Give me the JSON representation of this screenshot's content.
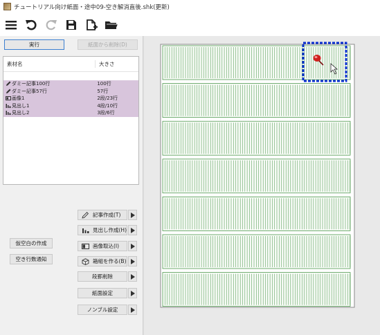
{
  "window": {
    "title": "チュートリアル向け紙面・途中09-空き解消直後.shk(更新)"
  },
  "toolbar": {
    "items": [
      {
        "icon": "menu-icon"
      },
      {
        "icon": "undo-icon"
      },
      {
        "icon": "redo-icon"
      },
      {
        "icon": "save-icon"
      },
      {
        "icon": "new-document-icon"
      },
      {
        "icon": "open-folder-icon"
      }
    ]
  },
  "actions": {
    "execute": "実行",
    "remove_from_page": "紙面から削除(D)"
  },
  "materials": {
    "columns": [
      "素材名",
      "大きさ"
    ],
    "rows": [
      {
        "icon": "pencil-icon",
        "name": "ダミー記事100行",
        "size": "100行"
      },
      {
        "icon": "pencil-icon",
        "name": "ダミー記事57行",
        "size": "57行"
      },
      {
        "icon": "image-icon",
        "name": "画像1",
        "size": "2段/23行"
      },
      {
        "icon": "headline-icon",
        "name": "見出し1",
        "size": "4段/10行"
      },
      {
        "icon": "headline-icon",
        "name": "見出し2",
        "size": "3段/6行"
      }
    ]
  },
  "commands": {
    "create_article": "記事作成(T)",
    "create_headline": "見出し作成(H)",
    "import_image": "画像取込(I)",
    "make_box": "箱組を作る(B)",
    "delete_columns": "段罫削除",
    "page_settings": "紙面設定",
    "nombre_settings": "ノンブル設定",
    "dummy_white_space": "仮空白の作成",
    "empty_line_notice": "空き行数通知"
  },
  "colors": {
    "accent": "#3c7fd0",
    "material_row_bg": "#d8c5dc",
    "grid_line": "#4f9a4f",
    "selection": "#0a2fd0",
    "pin": "#d0201e"
  }
}
